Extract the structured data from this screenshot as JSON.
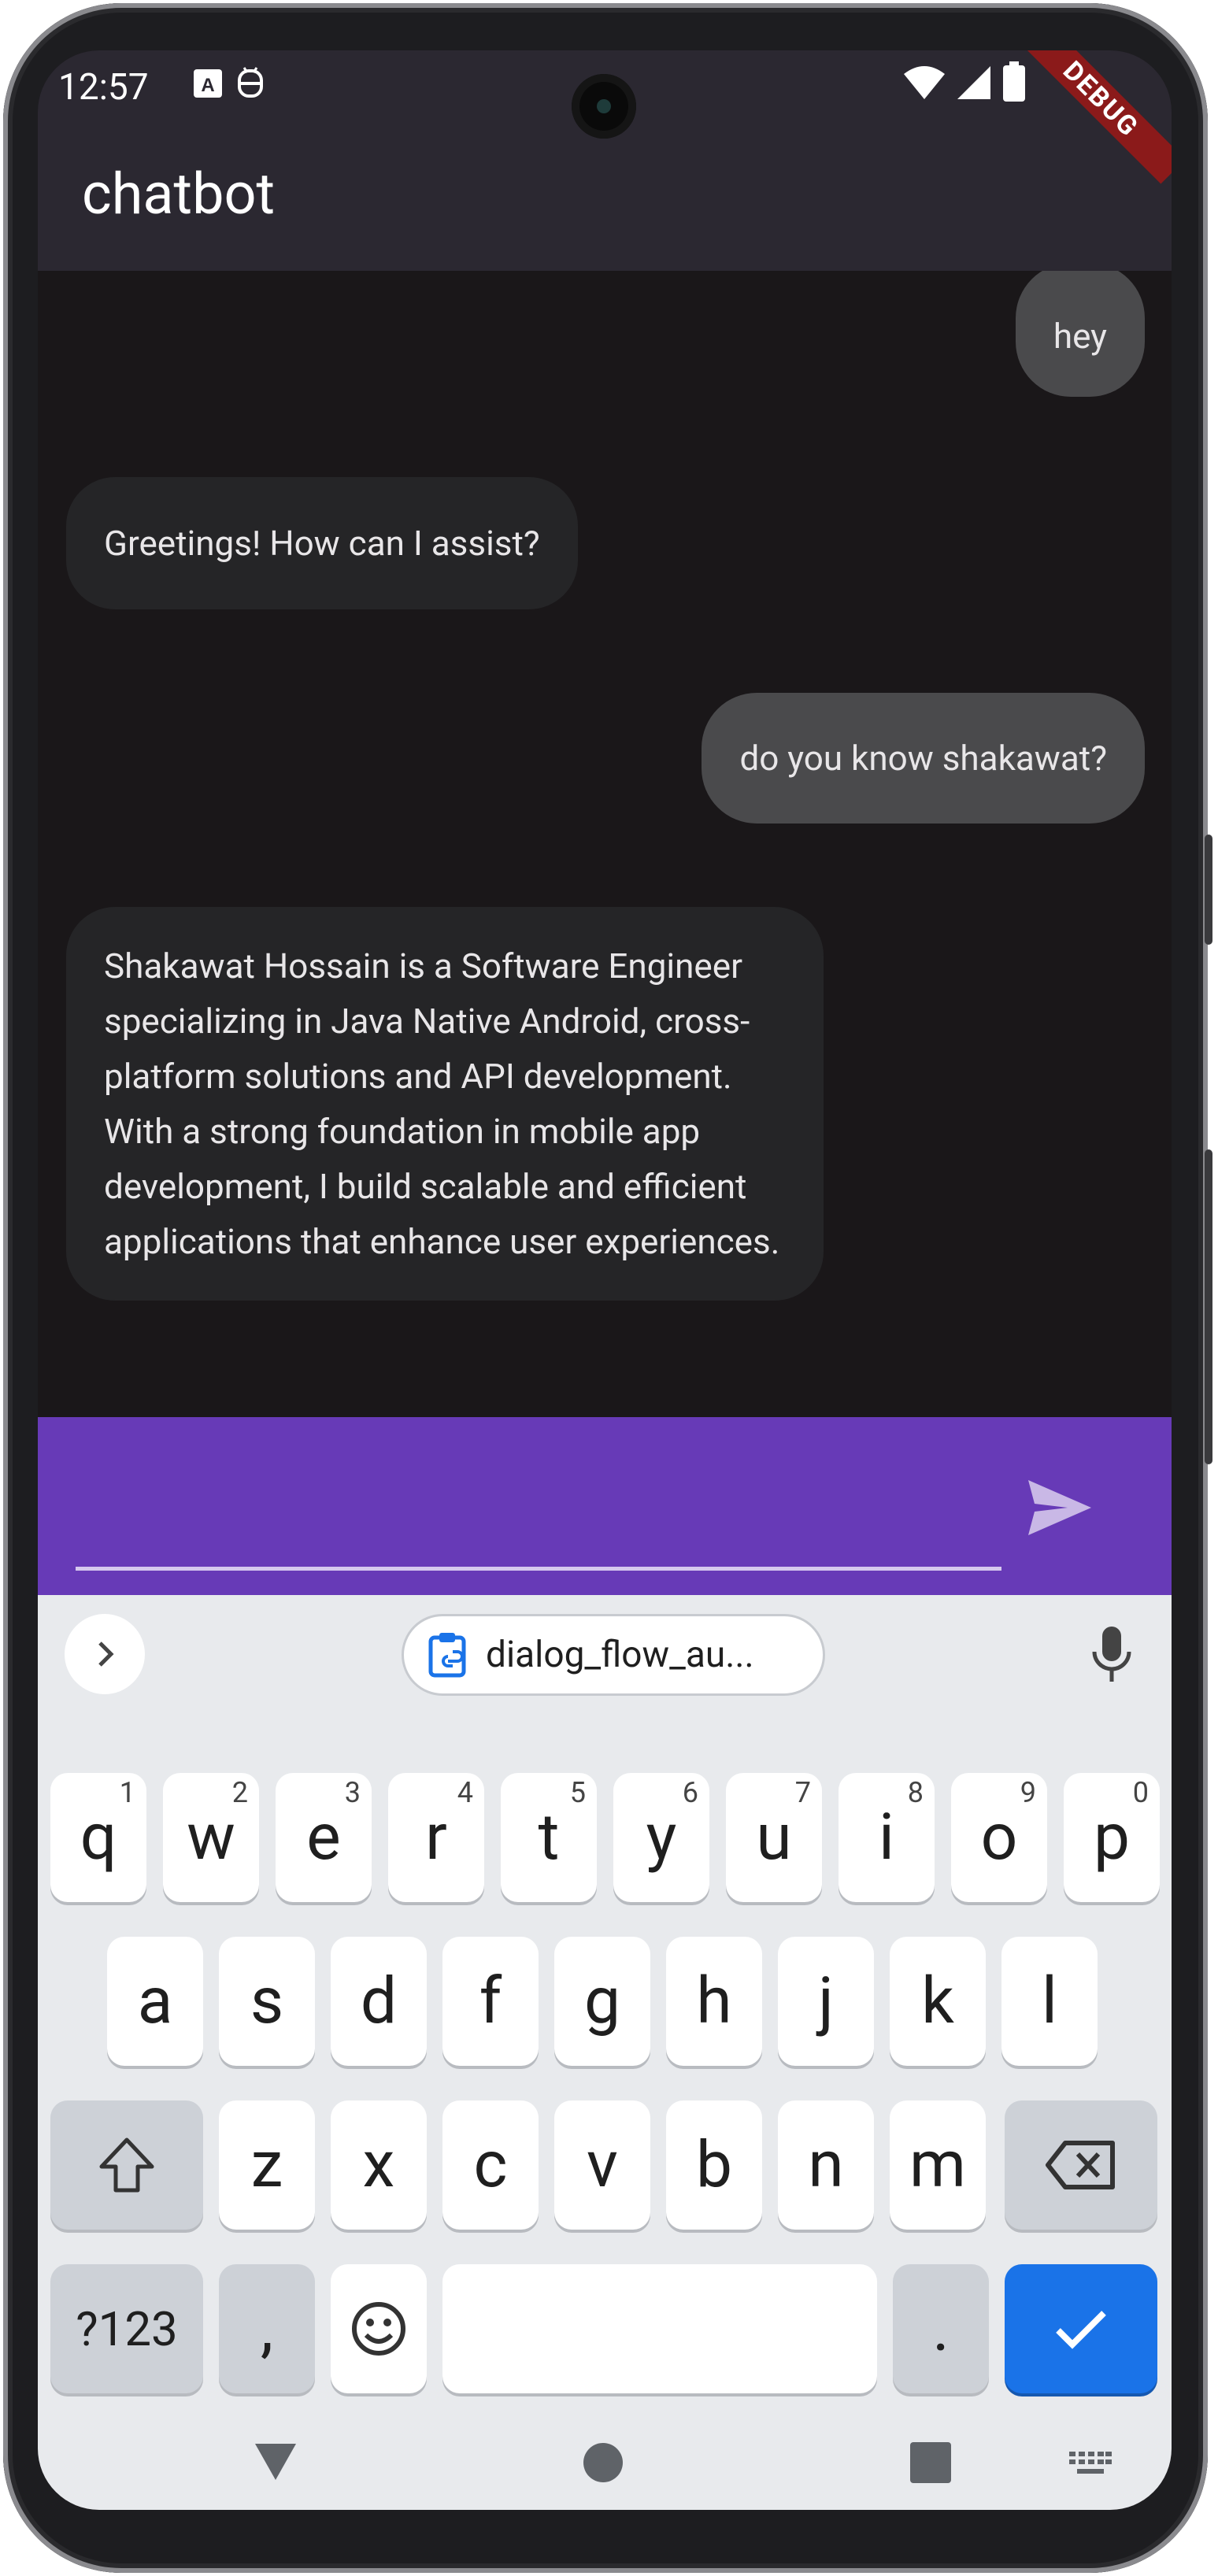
{
  "status_bar": {
    "time": "12:57"
  },
  "app_bar": {
    "title": "chatbot",
    "debug_label": "DEBUG"
  },
  "messages": [
    {
      "sender": "user",
      "text": "hey"
    },
    {
      "sender": "bot",
      "text": "Greetings! How can I assist?"
    },
    {
      "sender": "user",
      "text": "do you know shakawat?"
    },
    {
      "sender": "bot",
      "text": "Shakawat Hossain is a Software Engineer specializing in Java Native Android, cross-platform solutions and API development. With a strong foundation in mobile app development, I build scalable and efficient applications that enhance user experiences."
    }
  ],
  "input": {
    "value": "",
    "placeholder": "",
    "accent": "#673ab7"
  },
  "keyboard": {
    "clipboard_chip": "dialog_flow_au...",
    "row1": [
      "q",
      "w",
      "e",
      "r",
      "t",
      "y",
      "u",
      "i",
      "o",
      "p"
    ],
    "row1_hints": [
      "1",
      "2",
      "3",
      "4",
      "5",
      "6",
      "7",
      "8",
      "9",
      "0"
    ],
    "row2": [
      "a",
      "s",
      "d",
      "f",
      "g",
      "h",
      "j",
      "k",
      "l"
    ],
    "row3": [
      "z",
      "x",
      "c",
      "v",
      "b",
      "n",
      "m"
    ],
    "symbols_key": "?123",
    "comma_key": ",",
    "period_key": ".",
    "enter_color": "#1a73e8"
  }
}
